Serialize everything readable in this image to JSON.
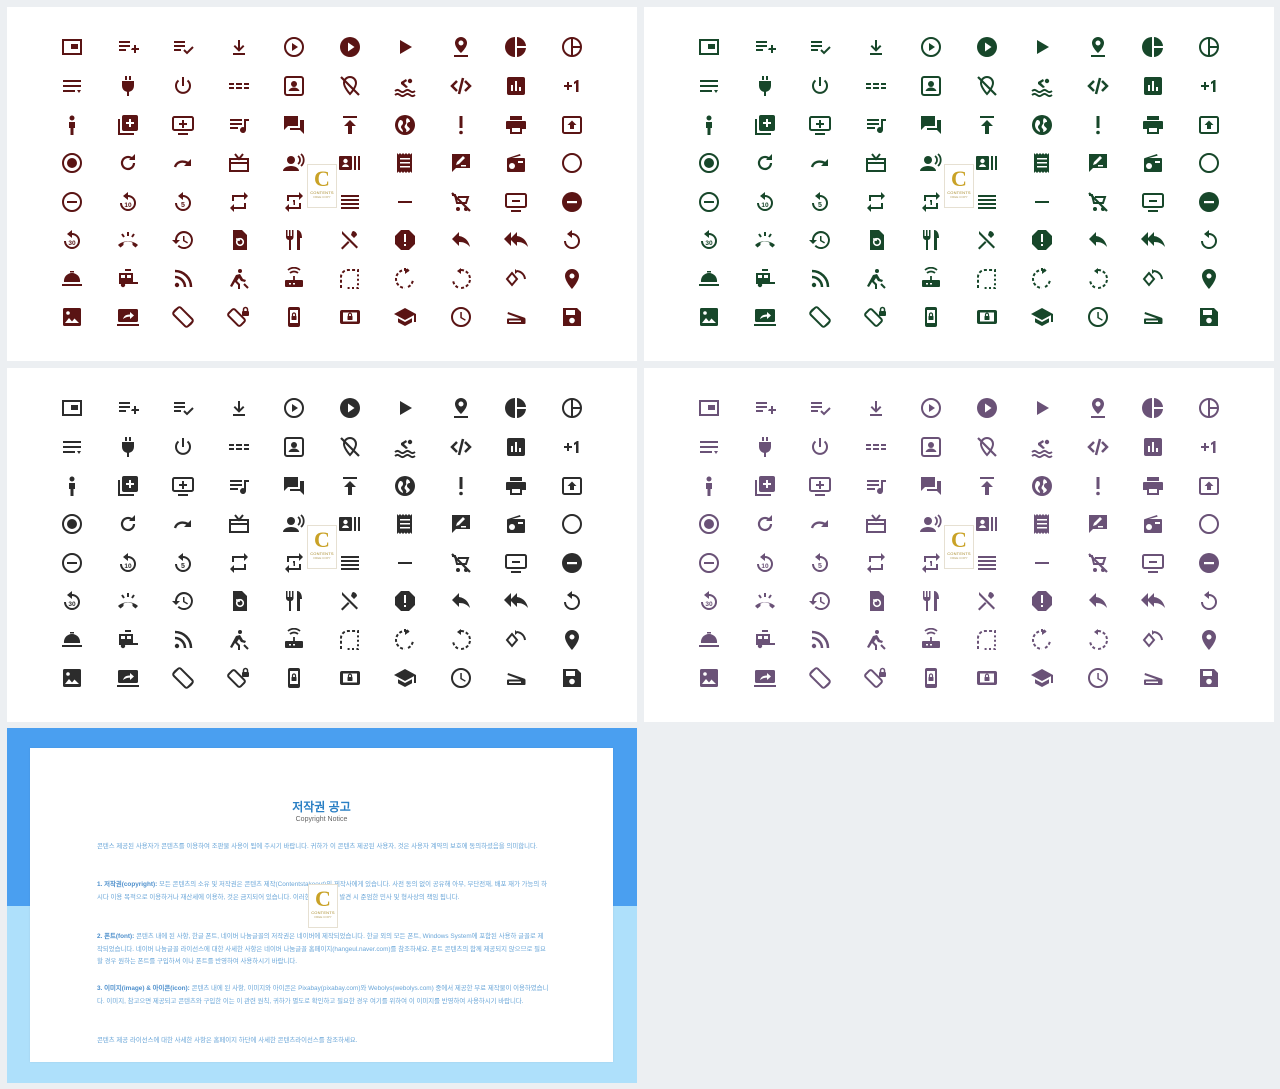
{
  "icon_names": [
    "picture-in-picture-icon",
    "playlist-add-icon",
    "playlist-add-check-icon",
    "download-icon",
    "play-circle-outline-icon",
    "play-circle-filled-icon",
    "play-arrow-icon",
    "location-pin-icon",
    "pie-chart-icon",
    "pie-chart-outline-icon",
    "sort-lines-icon",
    "power-plug-icon",
    "power-settings-icon",
    "dashes-icon",
    "account-box-icon",
    "location-off-icon",
    "pool-icon",
    "code-off-icon",
    "bar-chart-box-icon",
    "plus-one-icon",
    "person-icon",
    "library-add-icon",
    "add-to-queue-icon",
    "queue-music-icon",
    "forum-icon",
    "publish-icon",
    "public-globe-icon",
    "priority-high-icon",
    "print-icon",
    "publish-box-icon",
    "radio-button-checked-icon",
    "refresh-icon",
    "redo-icon",
    "redeem-icon",
    "record-voice-over-icon",
    "recent-actors-icon",
    "receipt-icon",
    "rate-review-icon",
    "radio-icon",
    "radio-button-unchecked-icon",
    "remove-circle-outline-icon",
    "replay-10-icon",
    "replay-5-icon",
    "repeat-icon",
    "repeat-one-icon",
    "reorder-icon",
    "remove-icon",
    "remove-shopping-cart-icon",
    "remove-from-queue-icon",
    "remove-circle-icon",
    "replay-30-icon",
    "ring-volume-icon",
    "restore-icon",
    "restore-page-icon",
    "restaurant-icon",
    "restaurant-menu-icon",
    "report-icon",
    "reply-icon",
    "reply-all-icon",
    "replay-icon",
    "room-service-icon",
    "rv-hookup-icon",
    "rss-feed-icon",
    "rowing-icon",
    "router-icon",
    "rounded-corner-icon",
    "rotate-right-icon",
    "rotate-left-icon",
    "rotate-90-icon",
    "room-icon",
    "photo-icon",
    "screen-share-icon",
    "screen-rotation-icon",
    "screen-lock-rotation-icon",
    "screen-lock-portrait-icon",
    "screen-lock-landscape-icon",
    "school-icon",
    "schedule-icon",
    "scanner-icon",
    "save-icon"
  ],
  "panels": [
    {
      "color": "#5a1414"
    },
    {
      "color": "#17472a"
    },
    {
      "color": "#2c2c2c"
    },
    {
      "color": "#6a5277"
    }
  ],
  "badge": {
    "letter": "C",
    "text": "CONTENTS",
    "sub": "FREE COPY"
  },
  "notice": {
    "title": "저작권 공고",
    "subtitle": "Copyright Notice",
    "paragraphs": [
      {
        "head": "",
        "body": "콘텐스 제공된 사용자가 콘텐츠를 이용하여 조판물 사용이 됨에 주시기 바랍니다. 귀하가 이 콘텐츠 제공된 사용자, 것은 사용자 계약의 보호에 동의하셨음을 의미합니다."
      },
      {
        "head": "1. 저작권(copyright):",
        "body": " 모든 콘텐츠의 소유 및 저작권은 콘텐츠 제작(Contentstakeout)의 제작사에게 있습니다. 사전 동의 없이 공유해 아무, 무단전재, 배포 재가 가능의 하시다 이용 목적으로 이용하거나 재산세에 이용하, 것은 금지되어 있습니다. 이러한 규칙 위반 발견 시 준엄한 민사 및 형사상의 책임 됩니다."
      },
      {
        "head": "2. 폰트(font):",
        "body": " 콘텐츠 내에 된 사항, 한글 폰트, 네이버 나눔글꼴의 저작권은 네이버에 제작되었습니다. 한글 외의 모든 폰트, Windows System에 포함된 사용하 글꼴로 제작되었습니다. 네이버 나눔글꼴 라이선스에 대한 사세한 사항은 네이버 나눔글꼴 홈페이지(hangeul.naver.com)를 참조하세요. 폰트 콘텐츠의 함께 제공되지 않으므로 필요할 경우 원하는 폰트를 구입하셔 이나 폰트를 반영하여 사용하시기 바랍니다."
      },
      {
        "head": "3. 이미지(image) & 아이콘(icon):",
        "body": " 콘텐츠 내에 된 사항, 이미지와 아이콘은 Pixabay(pixabay.com)와 Webolys(webolys.com) 중에서 제공한 무료 제작물이 이용하였습니다. 이미지, 참고으면 제공되고 콘텐츠와 구입한 이는 이 관련 원칙, 귀하가 별도로 확인하고 필요한 경우 여기를 위하여 이 이미지를 반영하여 사용하시기 바랍니다."
      },
      {
        "head": "",
        "body": "콘텐츠 제공 라이선스에 대한 사세한 사항은 홈페이지 하단에 사세한 콘텐츠라이선스를 참조하세요."
      }
    ]
  }
}
